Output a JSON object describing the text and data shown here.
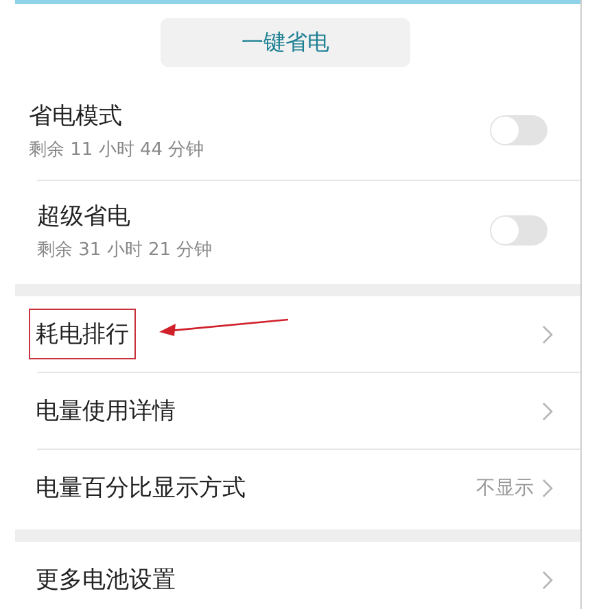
{
  "top_button": {
    "label": "一键省电"
  },
  "toggles": [
    {
      "title": "省电模式",
      "subtitle": "剩余 11 小时 44 分钟",
      "on": false
    },
    {
      "title": "超级省电",
      "subtitle": "剩余 31 小时 21 分钟",
      "on": false
    }
  ],
  "groups": [
    {
      "items": [
        {
          "label": "耗电排行",
          "highlighted": true
        },
        {
          "label": "电量使用详情",
          "highlighted": false
        },
        {
          "label": "电量百分比显示方式",
          "value": "不显示",
          "highlighted": false
        }
      ]
    },
    {
      "items": [
        {
          "label": "更多电池设置",
          "highlighted": false
        }
      ]
    }
  ]
}
